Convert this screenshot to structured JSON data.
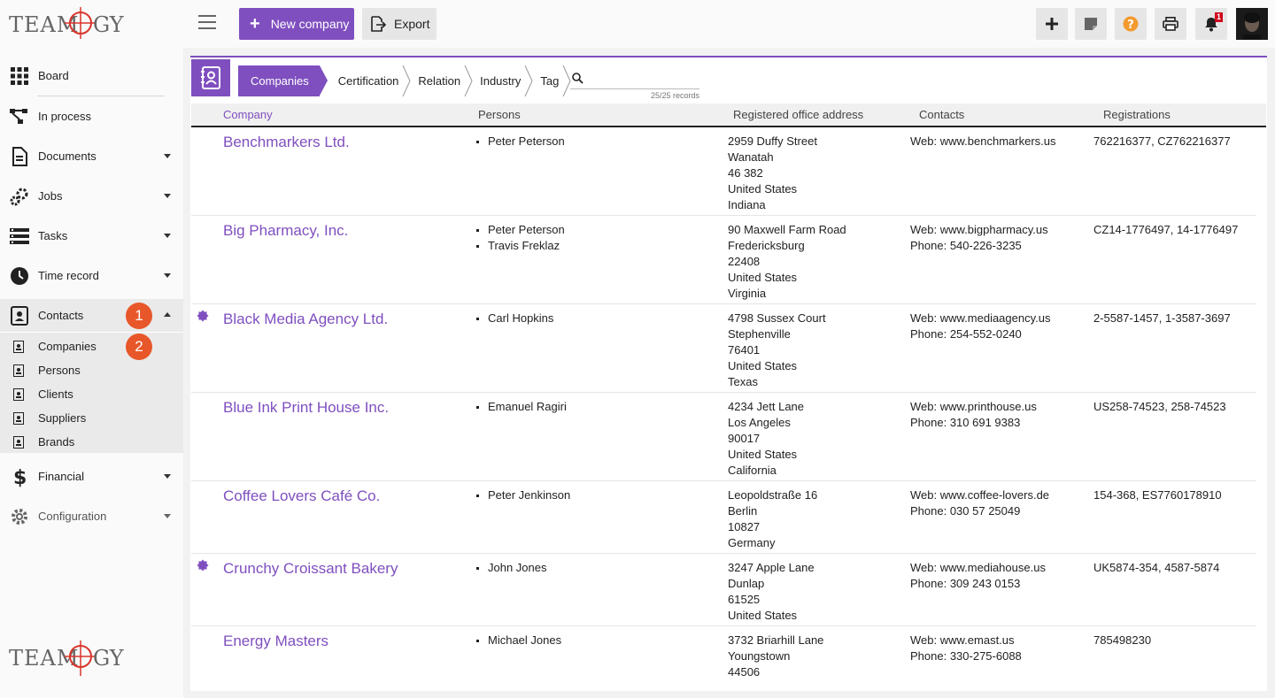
{
  "brand": {
    "name": "TEAMOGY",
    "accent": "#7f4fbf",
    "badge_color": "#e8572a"
  },
  "sidebar": {
    "items": [
      {
        "label": "Board",
        "icon": "grid-icon"
      },
      {
        "label": "In process",
        "icon": "workflow-icon"
      },
      {
        "label": "Documents",
        "icon": "document-icon"
      },
      {
        "label": "Jobs",
        "icon": "gears-icon"
      },
      {
        "label": "Tasks",
        "icon": "tasks-icon"
      },
      {
        "label": "Time record",
        "icon": "clock-icon"
      },
      {
        "label": "Contacts",
        "icon": "contacts-icon"
      },
      {
        "label": "Financial",
        "icon": "dollar-icon"
      },
      {
        "label": "Configuration",
        "icon": "gear-icon"
      }
    ],
    "contacts_sub": [
      "Companies",
      "Persons",
      "Clients",
      "Suppliers",
      "Brands"
    ],
    "badges": [
      "1",
      "2"
    ]
  },
  "toolbar": {
    "new_company": "New company",
    "export": "Export",
    "notification_count": "1"
  },
  "tabs": [
    "Companies",
    "Certification",
    "Relation",
    "Industry",
    "Tag"
  ],
  "search": {
    "placeholder": "",
    "records": "25/25 records"
  },
  "table": {
    "headers": [
      "Company",
      "Persons",
      "Registered office address",
      "Contacts",
      "Registrations"
    ],
    "rows": [
      {
        "company": "Benchmarkers Ltd.",
        "starred": false,
        "persons": [
          "Peter Peterson"
        ],
        "address": [
          "2959 Duffy Street",
          "Wanatah",
          "46 382",
          "United States",
          "Indiana"
        ],
        "contacts": [
          "Web: www.benchmarkers.us"
        ],
        "registrations": "762216377, CZ762216377"
      },
      {
        "company": "Big Pharmacy, Inc.",
        "starred": false,
        "persons": [
          "Peter Peterson",
          "Travis Freklaz"
        ],
        "address": [
          "90 Maxwell Farm Road",
          "Fredericksburg",
          "22408",
          "United States",
          "Virginia"
        ],
        "contacts": [
          "Web: www.bigpharmacy.us",
          "Phone: 540-226-3235"
        ],
        "registrations": "CZ14-1776497, 14-1776497"
      },
      {
        "company": "Black Media Agency Ltd.",
        "starred": true,
        "persons": [
          "Carl Hopkins"
        ],
        "address": [
          "4798 Sussex Court",
          "Stephenville",
          "76401",
          "United States",
          "Texas"
        ],
        "contacts": [
          "Web: www.mediaagency.us",
          "Phone: 254-552-0240"
        ],
        "registrations": "2-5587-1457, 1-3587-3697"
      },
      {
        "company": "Blue Ink Print House Inc.",
        "starred": false,
        "persons": [
          "Emanuel Ragiri"
        ],
        "address": [
          "4234 Jett Lane",
          "Los Angeles",
          "90017",
          "United States",
          "California"
        ],
        "contacts": [
          "Web: www.printhouse.us",
          "Phone: 310 691 9383"
        ],
        "registrations": "US258-74523, 258-74523"
      },
      {
        "company": "Coffee Lovers Café Co.",
        "starred": false,
        "persons": [
          "Peter Jenkinson"
        ],
        "address": [
          "Leopoldstraße 16",
          "Berlin",
          "10827",
          "Germany"
        ],
        "contacts": [
          "Web: www.coffee-lovers.de",
          "Phone: 030 57 25049"
        ],
        "registrations": "154-368, ES7760178910"
      },
      {
        "company": "Crunchy Croissant Bakery",
        "starred": true,
        "persons": [
          "John Jones"
        ],
        "address": [
          "3247 Apple Lane",
          "Dunlap",
          "61525",
          "United States"
        ],
        "contacts": [
          "Web: www.mediahouse.us",
          "Phone: 309 243 0153"
        ],
        "registrations": "UK5874-354, 4587-5874"
      },
      {
        "company": "Energy Masters",
        "starred": false,
        "persons": [
          "Michael Jones"
        ],
        "address": [
          "3732 Briarhill Lane",
          "Youngstown",
          "44506"
        ],
        "contacts": [
          "Web: www.emast.us",
          "Phone: 330-275-6088"
        ],
        "registrations": "785498230"
      }
    ]
  }
}
